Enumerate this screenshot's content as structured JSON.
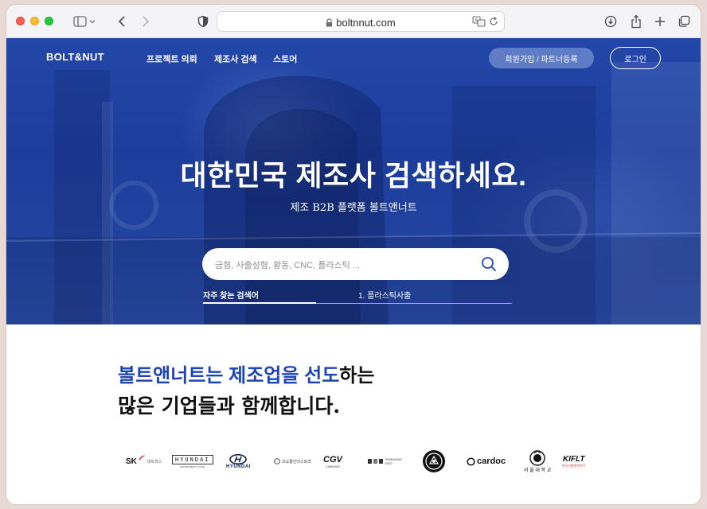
{
  "browser": {
    "url": "boltnnut.com"
  },
  "nav": {
    "logo": "BOLT&NUT",
    "links": [
      "프로젝트 의뢰",
      "제조사 검색",
      "스토어"
    ],
    "join_partner": "회원가입 / 파트너등록",
    "login": "로그인"
  },
  "hero": {
    "headline": "대한민국 제조사 검색하세요.",
    "subheadline": "제조 B2B 플랫폼 볼트앤너트",
    "search_placeholder": "금형, 사출성형, 황동, CNC, 플라스틱 ...",
    "popular_label": "자주 찾는 검색어",
    "popular_item": "1. 플라스틱사출"
  },
  "partners": {
    "tagline_blue": "볼트앤너트는 제조업을 선도",
    "tagline_rest": "하는",
    "tagline_line2": "많은 기업들과 함께합니다.",
    "logos": {
      "sk_main": "SK",
      "sk_sub": "네트웍스",
      "hyundai_dept": "HYUNDAI",
      "hyundai_dept_sub": "DEPARTMENT STORE",
      "hyundai": "HYUNDAI",
      "kolon": "코오롱인더스트리",
      "cgv": "CGV",
      "cgv_sub": "CINEMAS",
      "shinsung": "SHINSUNG",
      "shinsung_sub": "E&G",
      "cardoc": "cardoc",
      "snu": "서 울 대 학 교",
      "kiflt_main": "KIFLT",
      "kiflt_sub": "한국신발피혁연구"
    }
  },
  "colors": {
    "hero_blue": "#1f3f9f",
    "accent_blue": "#1f45b4",
    "join_button": "#5f7cc6"
  }
}
